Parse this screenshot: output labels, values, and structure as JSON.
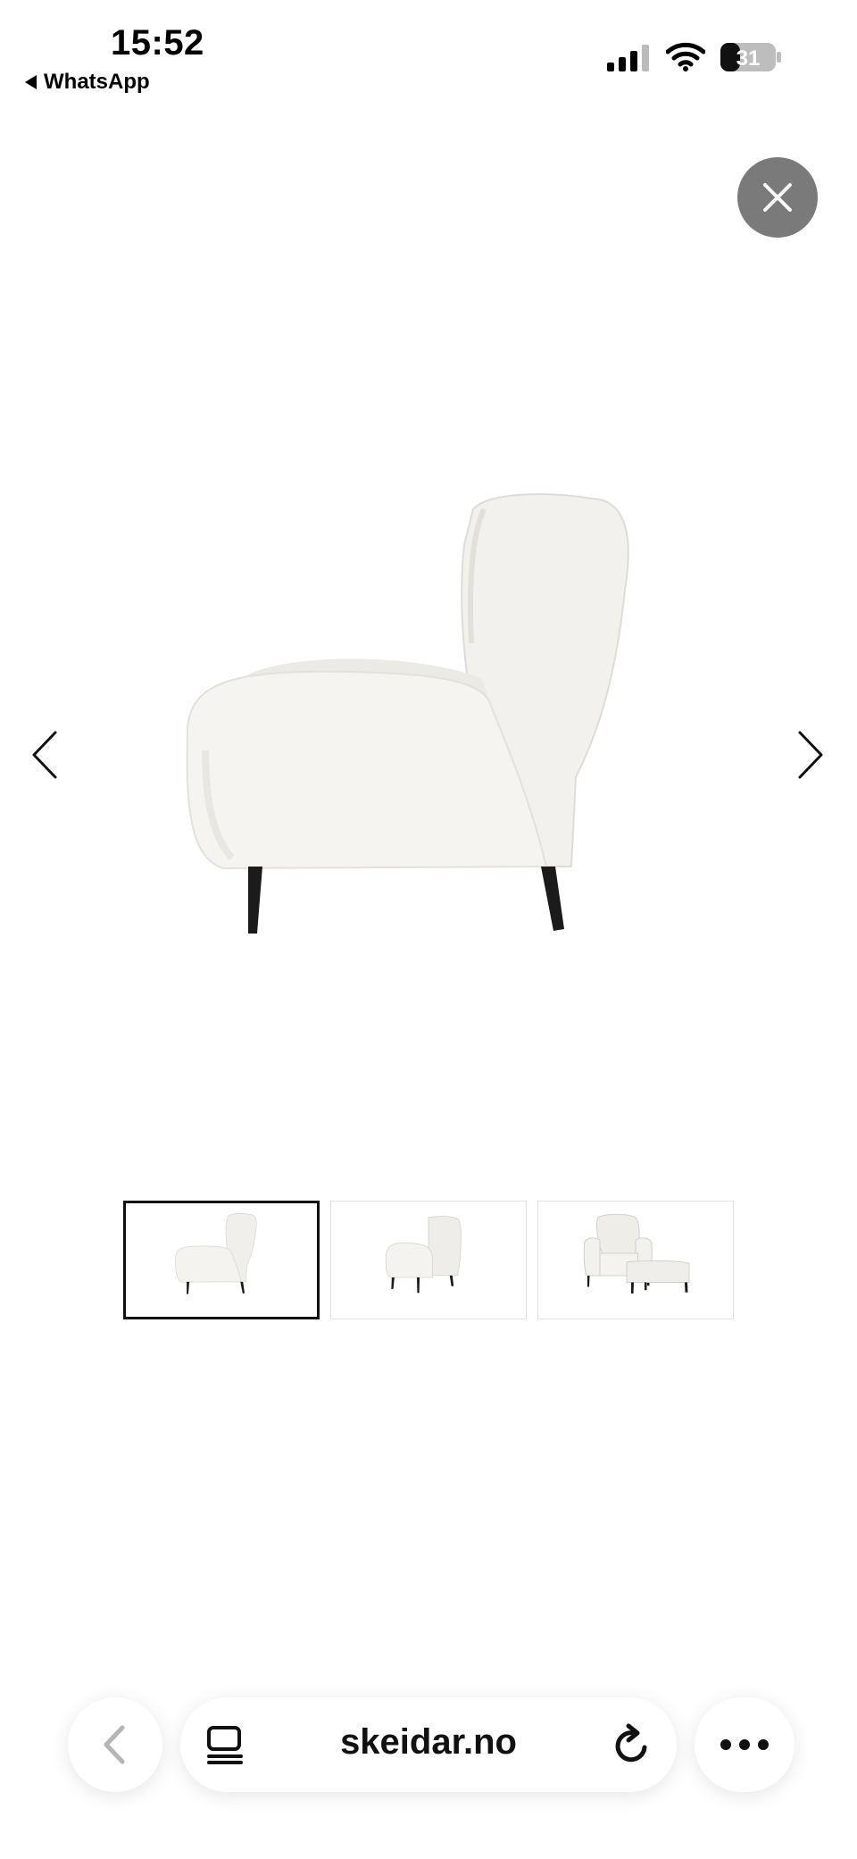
{
  "status_bar": {
    "time": "15:52",
    "back_app": "WhatsApp",
    "battery_level": "31"
  },
  "gallery": {
    "close_icon": "close-icon",
    "prev_icon": "chevron-left-icon",
    "next_icon": "chevron-right-icon",
    "main_image": "armchair-side-view",
    "thumbnails": [
      {
        "name": "armchair-side-view",
        "selected": true
      },
      {
        "name": "armchair-back-view",
        "selected": false
      },
      {
        "name": "armchair-with-footstool",
        "selected": false
      }
    ]
  },
  "browser_toolbar": {
    "back_icon": "chevron-left-icon",
    "reader_icon": "reader-icon",
    "domain": "skeidar.no",
    "reload_icon": "reload-icon",
    "more_icon": "more-icon"
  }
}
